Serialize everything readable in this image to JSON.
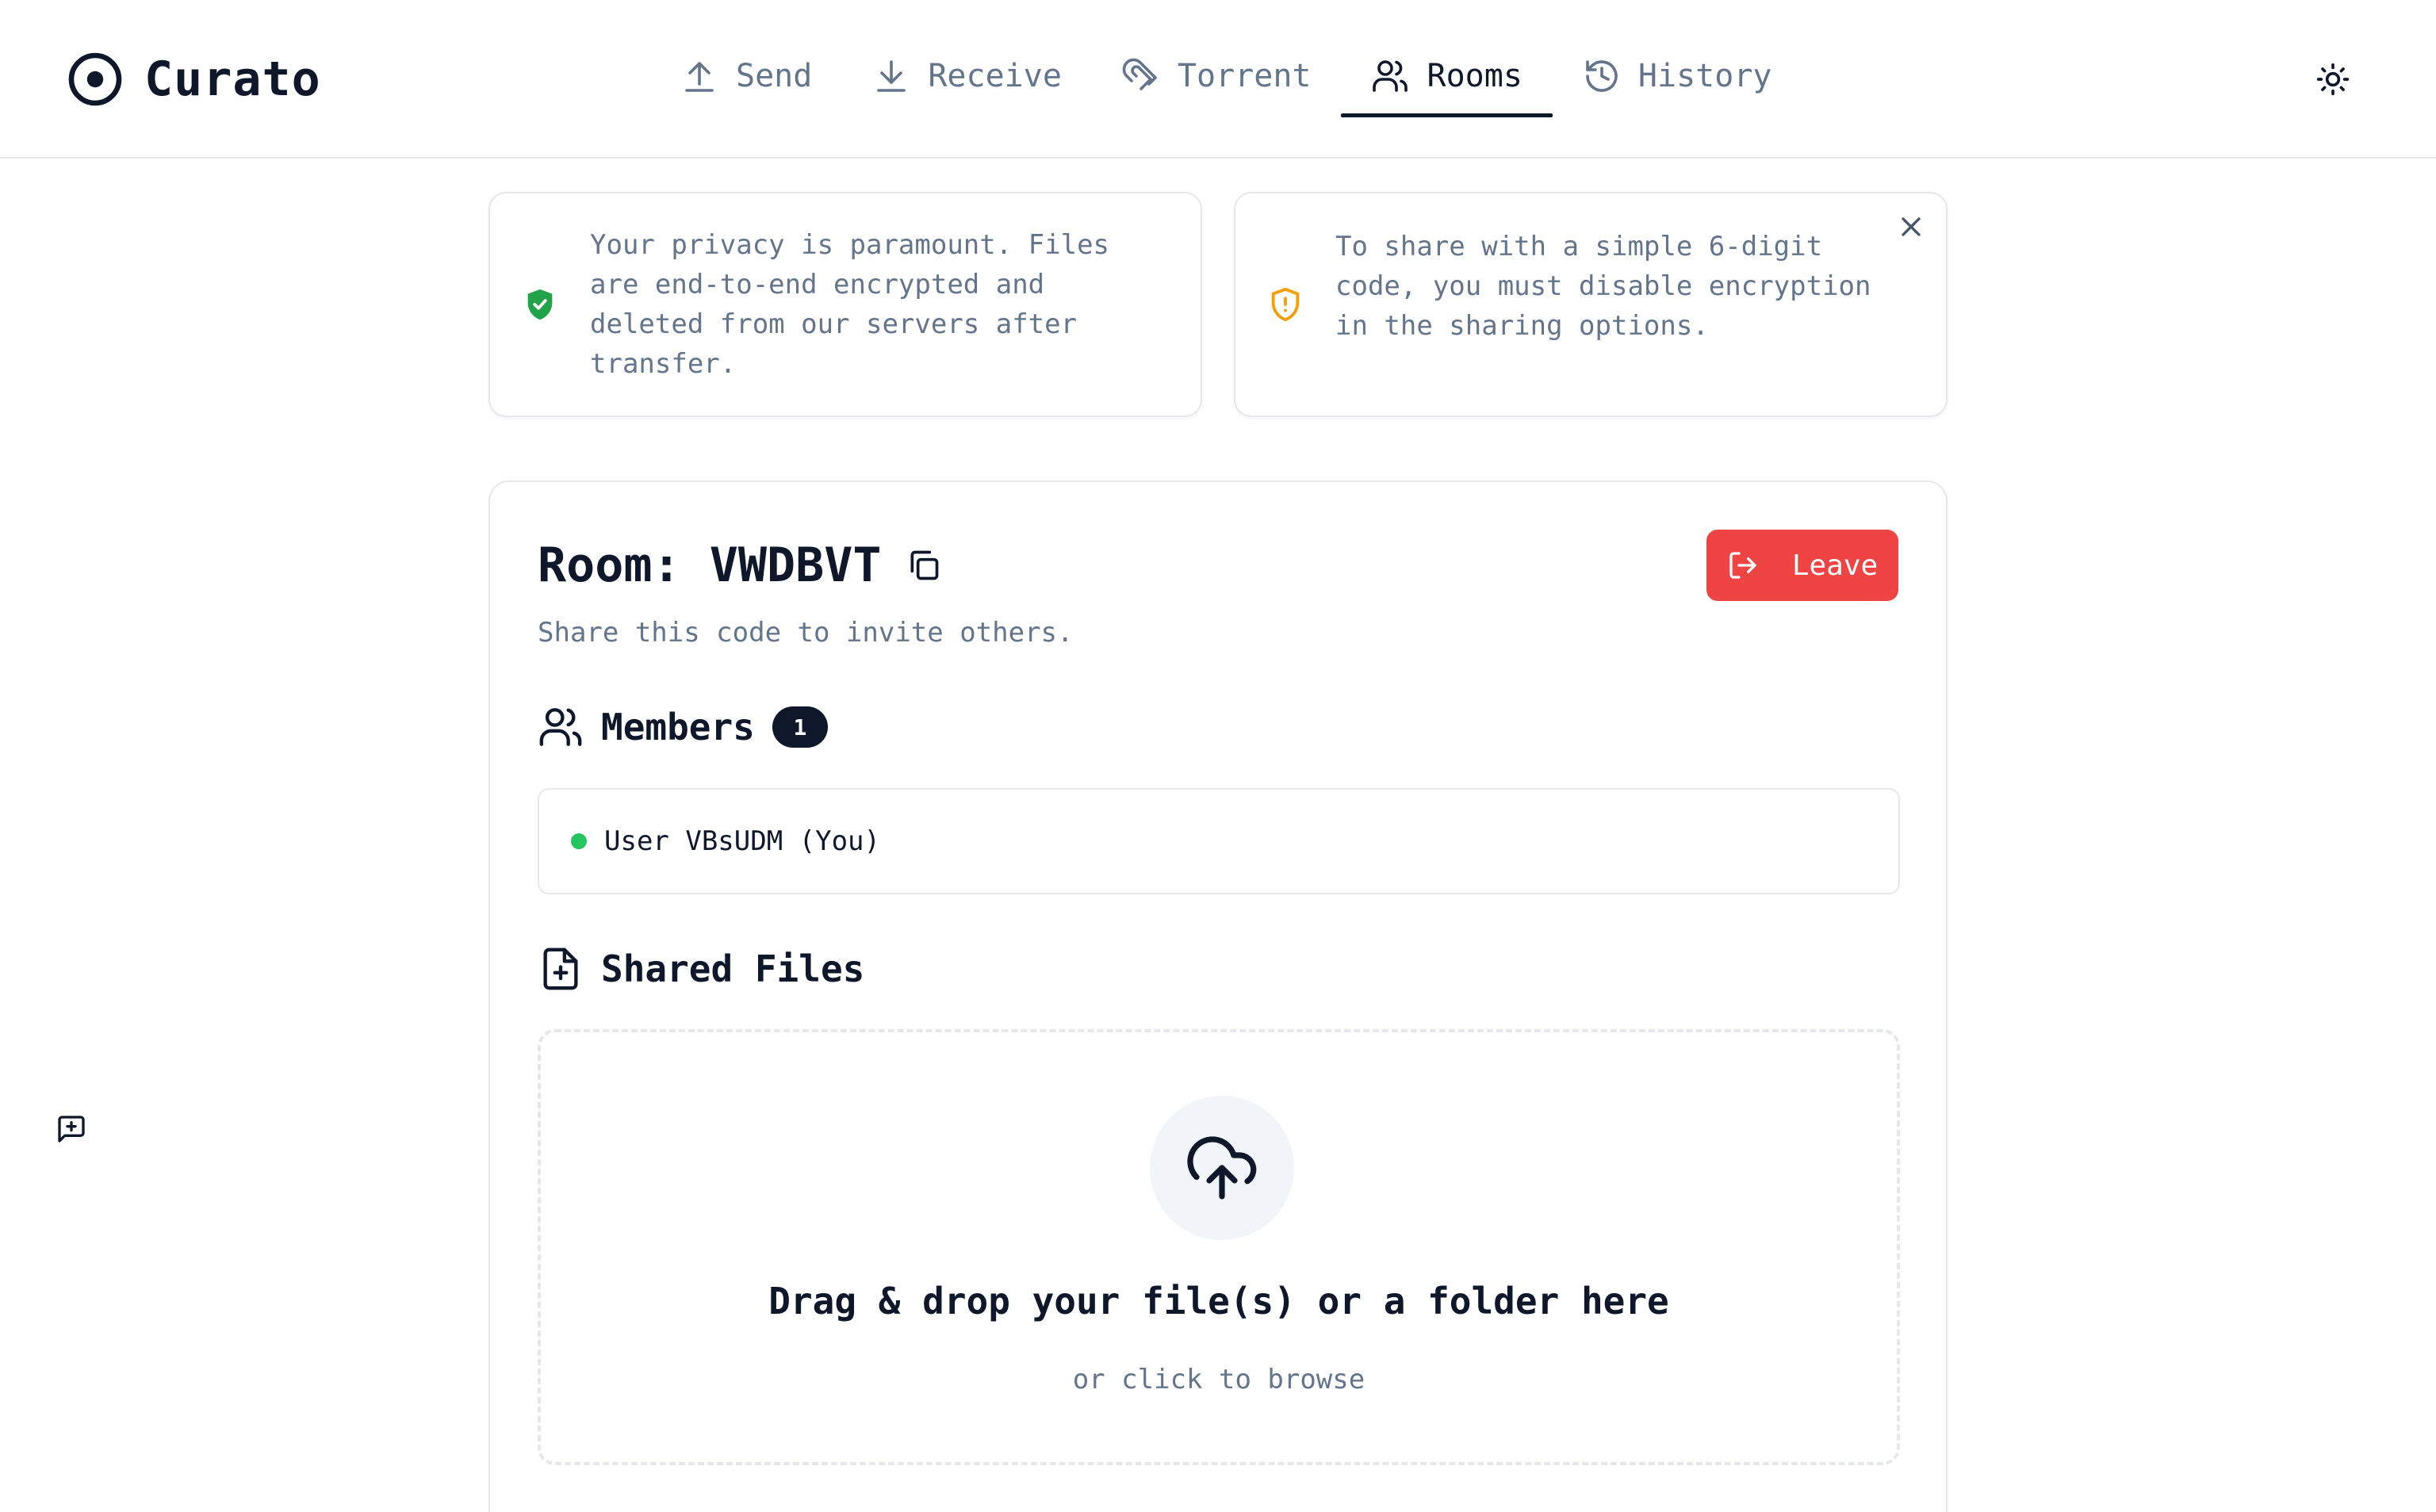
{
  "app": {
    "name": "Curato"
  },
  "nav": {
    "tabs": [
      {
        "label": "Send",
        "icon": "upload-icon",
        "active": false
      },
      {
        "label": "Receive",
        "icon": "download-icon",
        "active": false
      },
      {
        "label": "Torrent",
        "icon": "magnet-icon",
        "active": false
      },
      {
        "label": "Rooms",
        "icon": "users-icon",
        "active": true
      },
      {
        "label": "History",
        "icon": "history-icon",
        "active": false
      }
    ]
  },
  "theme_toggle": {
    "icon": "sun-icon"
  },
  "notices": {
    "privacy": {
      "text": "Your privacy is paramount. Files are end-to-end encrypted and deleted from our servers after transfer.",
      "icon": "shield-check-icon",
      "color": "#22a34a"
    },
    "encryption": {
      "text": "To share with a simple 6-digit code, you must disable encryption in the sharing options.",
      "icon": "shield-alert-icon",
      "color": "#f59e0b"
    }
  },
  "room": {
    "title": "Room: VWDBVT",
    "subtitle": "Share this code to invite others.",
    "leave_label": "Leave",
    "leave_color": "#ef4444"
  },
  "members": {
    "heading": "Members",
    "count": "1",
    "list": [
      {
        "name": "User VBsUDM (You)",
        "status_color": "#22c55e"
      }
    ]
  },
  "shared_files": {
    "heading": "Shared Files",
    "drop_title": "Drag & drop your file(s) or a folder here",
    "drop_subtitle": "or click to browse"
  }
}
